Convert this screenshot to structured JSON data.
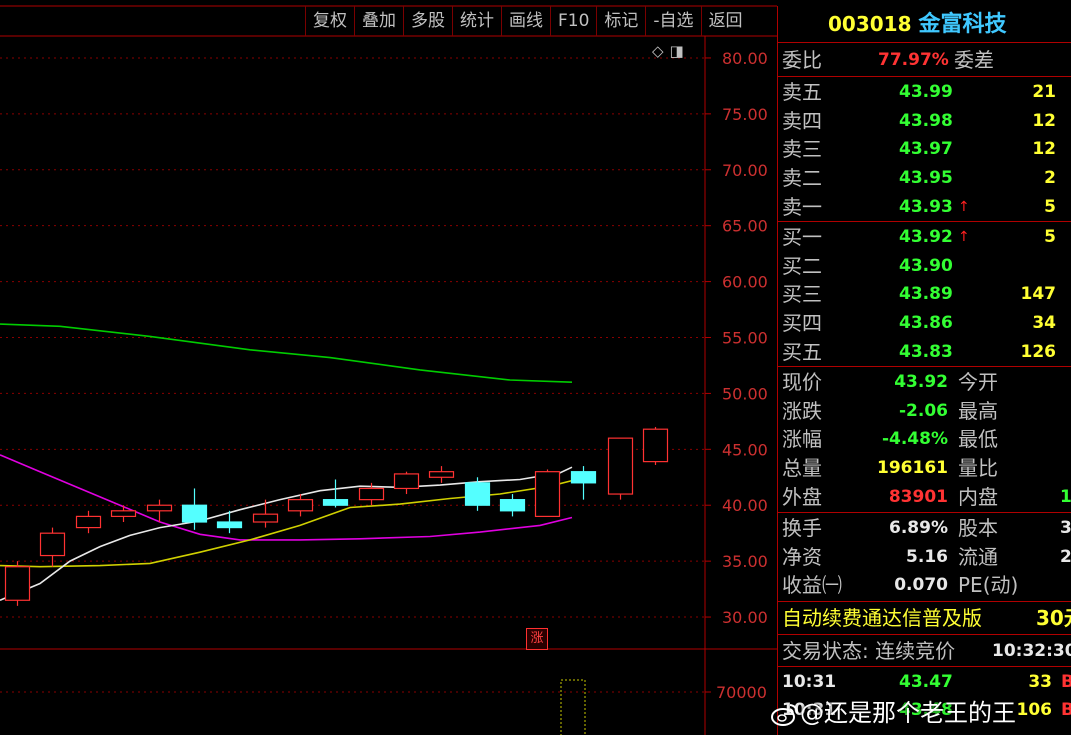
{
  "toolbar": [
    "复权",
    "叠加",
    "多股",
    "统计",
    "画线",
    "F10",
    "标记",
    "-自选",
    "返回"
  ],
  "corner_icons": [
    "diamond-icon",
    "window-icon"
  ],
  "price_axis": [
    "80.00",
    "75.00",
    "70.00",
    "65.00",
    "60.00",
    "55.00",
    "50.00",
    "45.00",
    "40.00",
    "35.00",
    "30.00"
  ],
  "volume_axis": [
    "70000"
  ],
  "chart_badge": "涨",
  "chart_data": {
    "type": "candlestick",
    "ylim": [
      27.5,
      82.5
    ],
    "yticks": [
      80,
      75,
      70,
      65,
      60,
      55,
      50,
      45,
      40,
      35,
      30
    ],
    "candles": [
      {
        "open": 31.5,
        "close": 34.5,
        "high": 35.0,
        "low": 31.0
      },
      {
        "open": 35.5,
        "close": 37.5,
        "high": 38.0,
        "low": 34.5
      },
      {
        "open": 38.0,
        "close": 39.0,
        "high": 39.5,
        "low": 37.5
      },
      {
        "open": 39.0,
        "close": 39.5,
        "high": 40.0,
        "low": 38.5
      },
      {
        "open": 39.5,
        "close": 40.0,
        "high": 40.5,
        "low": 38.5
      },
      {
        "open": 40.0,
        "close": 38.5,
        "high": 41.5,
        "low": 37.8
      },
      {
        "open": 38.5,
        "close": 38.0,
        "high": 39.5,
        "low": 37.5
      },
      {
        "open": 38.5,
        "close": 39.2,
        "high": 40.5,
        "low": 38.0
      },
      {
        "open": 39.5,
        "close": 40.5,
        "high": 41.0,
        "low": 39.0
      },
      {
        "open": 40.5,
        "close": 40.0,
        "high": 42.3,
        "low": 39.8
      },
      {
        "open": 40.5,
        "close": 41.5,
        "high": 42.0,
        "low": 40.0
      },
      {
        "open": 41.5,
        "close": 42.8,
        "high": 43.0,
        "low": 41.0
      },
      {
        "open": 42.5,
        "close": 43.0,
        "high": 43.5,
        "low": 42.0
      },
      {
        "open": 42.0,
        "close": 40.0,
        "high": 42.5,
        "low": 39.5
      },
      {
        "open": 40.5,
        "close": 39.5,
        "high": 41.0,
        "low": 39.0
      },
      {
        "open": 39.0,
        "close": 43.0,
        "high": 43.2,
        "low": 39.0
      },
      {
        "open": 43.0,
        "close": 42.0,
        "high": 43.5,
        "low": 40.5
      },
      {
        "open": 41.0,
        "close": 46.0,
        "high": 46.0,
        "low": 40.5
      },
      {
        "open": 43.9,
        "close": 46.8,
        "high": 47.0,
        "low": 43.6
      }
    ],
    "candle_x": [
      5,
      40,
      76,
      111,
      147,
      182,
      217,
      253,
      288,
      323,
      359,
      394,
      429,
      465,
      500,
      535,
      571,
      608,
      643
    ],
    "ma_series": [
      {
        "color": "#00cc00",
        "points": [
          [
            0,
            56.2
          ],
          [
            60,
            56.0
          ],
          [
            150,
            55.1
          ],
          [
            250,
            53.9
          ],
          [
            330,
            53.2
          ],
          [
            420,
            52.1
          ],
          [
            510,
            51.2
          ],
          [
            572,
            51.0
          ]
        ]
      },
      {
        "color": "#e000e0",
        "points": [
          [
            0,
            44.5
          ],
          [
            40,
            43.0
          ],
          [
            80,
            41.5
          ],
          [
            120,
            40.0
          ],
          [
            160,
            38.5
          ],
          [
            200,
            37.4
          ],
          [
            240,
            36.9
          ],
          [
            300,
            36.9
          ],
          [
            360,
            37.0
          ],
          [
            430,
            37.2
          ],
          [
            480,
            37.6
          ],
          [
            540,
            38.2
          ],
          [
            572,
            38.9
          ]
        ]
      },
      {
        "color": "#d0d000",
        "points": [
          [
            0,
            34.6
          ],
          [
            40,
            34.5
          ],
          [
            100,
            34.6
          ],
          [
            150,
            34.8
          ],
          [
            200,
            35.8
          ],
          [
            250,
            36.9
          ],
          [
            300,
            38.2
          ],
          [
            350,
            39.8
          ],
          [
            400,
            40.1
          ],
          [
            450,
            40.6
          ],
          [
            500,
            41.0
          ],
          [
            550,
            41.7
          ],
          [
            572,
            42.2
          ]
        ]
      },
      {
        "color": "#e8e8e8",
        "points": [
          [
            0,
            31.5
          ],
          [
            40,
            33.0
          ],
          [
            70,
            35.0
          ],
          [
            100,
            36.3
          ],
          [
            130,
            37.3
          ],
          [
            160,
            38.0
          ],
          [
            200,
            38.6
          ],
          [
            240,
            39.6
          ],
          [
            280,
            40.5
          ],
          [
            320,
            41.3
          ],
          [
            360,
            41.7
          ],
          [
            400,
            41.6
          ],
          [
            440,
            41.8
          ],
          [
            480,
            42.1
          ],
          [
            520,
            42.3
          ],
          [
            560,
            42.9
          ],
          [
            572,
            43.4
          ]
        ]
      }
    ]
  },
  "quote": {
    "code": "003018",
    "name": "金富科技",
    "weibi_label": "委比",
    "weibi_value": "77.97%",
    "weicha_label": "委差",
    "sells": [
      {
        "label": "卖五",
        "price": "43.99",
        "vol": "21",
        "arrow": ""
      },
      {
        "label": "卖四",
        "price": "43.98",
        "vol": "12",
        "arrow": ""
      },
      {
        "label": "卖三",
        "price": "43.97",
        "vol": "12",
        "arrow": ""
      },
      {
        "label": "卖二",
        "price": "43.95",
        "vol": "2",
        "arrow": ""
      },
      {
        "label": "卖一",
        "price": "43.93",
        "vol": "5",
        "arrow": "↑"
      }
    ],
    "buys": [
      {
        "label": "买一",
        "price": "43.92",
        "vol": "5",
        "arrow": "↑"
      },
      {
        "label": "买二",
        "price": "43.90",
        "vol": "",
        "arrow": ""
      },
      {
        "label": "买三",
        "price": "43.89",
        "vol": "147",
        "arrow": ""
      },
      {
        "label": "买四",
        "price": "43.86",
        "vol": "34",
        "arrow": ""
      },
      {
        "label": "买五",
        "price": "43.83",
        "vol": "126",
        "arrow": ""
      }
    ],
    "stats": [
      {
        "l1": "现价",
        "v1": "43.92",
        "c1": "green",
        "l2": "今开",
        "v2": ""
      },
      {
        "l1": "涨跌",
        "v1": "-2.06",
        "c1": "green",
        "l2": "最高",
        "v2": ""
      },
      {
        "l1": "涨幅",
        "v1": "-4.48%",
        "c1": "green",
        "l2": "最低",
        "v2": ""
      },
      {
        "l1": "总量",
        "v1": "196161",
        "c1": "yellow",
        "l2": "量比",
        "v2": ""
      },
      {
        "l1": "外盘",
        "v1": "83901",
        "c1": "red",
        "l2": "内盘",
        "v2": "1"
      }
    ],
    "stats2": [
      {
        "l1": "换手",
        "v1": "6.89%",
        "l2": "股本",
        "v2": "3"
      },
      {
        "l1": "净资",
        "v1": "5.16",
        "l2": "流通",
        "v2": "2"
      },
      {
        "l1": "收益㈠",
        "v1": "0.070",
        "l2": "PE(动)",
        "v2": ""
      }
    ],
    "banner_text": "自动续费通达信普及版",
    "banner_price": "30元",
    "trade_status": "交易状态: 连续竞价",
    "trade_time": "10:32:30",
    "ticks": [
      {
        "time": "10:31",
        "price": "43.47",
        "vol": "33",
        "flag": "B"
      },
      {
        "time": "10:31",
        "price": "43.48",
        "vol": "106",
        "flag": "B"
      }
    ]
  },
  "watermark": "@还是那个老王的王"
}
